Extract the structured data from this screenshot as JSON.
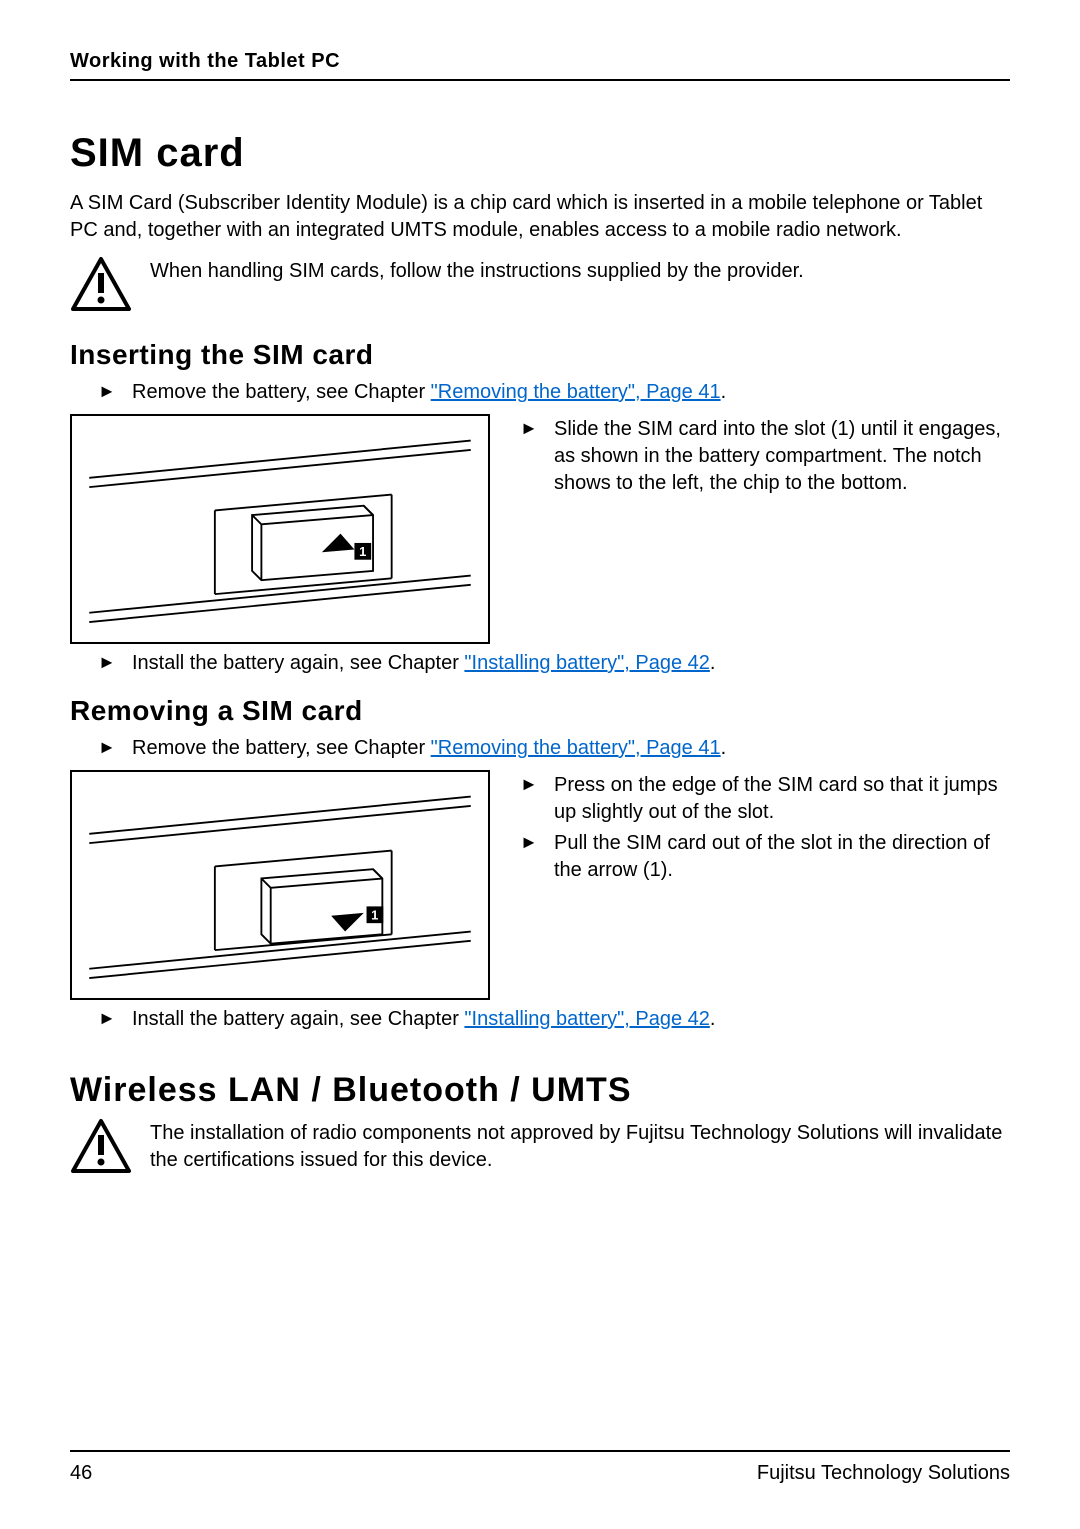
{
  "header": {
    "running_title": "Working with the Tablet PC"
  },
  "section1": {
    "title": "SIM card",
    "intro": "A SIM Card (Subscriber Identity Module) is a chip card which is inserted in a mobile telephone or Tablet PC and, together with an integrated UMTS module, enables access to a mobile radio network.",
    "caution": "When handling SIM cards, follow the instructions supplied by the provider."
  },
  "insert": {
    "title": "Inserting the SIM card",
    "step1_pre": "Remove the battery, see Chapter ",
    "step1_link": "\"Removing the battery\", Page 41",
    "step1_post": ".",
    "step2": "Slide the SIM card into the slot (1) until it engages, as shown in the battery compartment. The notch shows to the left, the chip to the bottom.",
    "step3_pre": "Install the battery again, see Chapter ",
    "step3_link": "\"Installing battery\", Page 42",
    "step3_post": "."
  },
  "remove": {
    "title": "Removing a SIM card",
    "step1_pre": "Remove the battery, see Chapter ",
    "step1_link": "\"Removing the battery\", Page 41",
    "step1_post": ".",
    "step2": "Press on the edge of the SIM card so that it jumps up slightly out of the slot.",
    "step3": "Pull the SIM card out of the slot in the direction of the arrow (1).",
    "step4_pre": "Install the battery again, see Chapter ",
    "step4_link": "\"Installing battery\", Page 42",
    "step4_post": "."
  },
  "section2": {
    "title": "Wireless LAN / Bluetooth / UMTS",
    "caution": "The installation of radio components not approved by Fujitsu Technology Solutions will invalidate the certifications issued for this device."
  },
  "footer": {
    "page": "46",
    "company": "Fujitsu Technology Solutions"
  }
}
